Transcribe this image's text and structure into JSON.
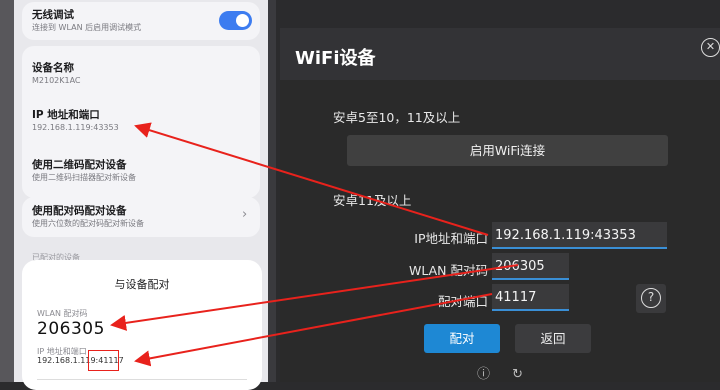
{
  "phone": {
    "wireless_debug": {
      "title": "无线调试",
      "sub": "连接到 WLAN 后启用调试模式"
    },
    "device_name": {
      "title": "设备名称",
      "sub": "M2102K1AC"
    },
    "ip_port": {
      "title": "IP 地址和端口",
      "sub": "192.168.1.119:43353"
    },
    "qr_pair": {
      "title": "使用二维码配对设备",
      "sub": "使用二维码扫描器配对新设备"
    },
    "code_pair": {
      "title": "使用配对码配对设备",
      "sub": "使用六位数的配对码配对新设备"
    },
    "faint": "已配对的设备",
    "pair_sheet": {
      "title": "与设备配对",
      "code_label": "WLAN 配对码",
      "code": "206305",
      "ip_label": "IP 地址和端口",
      "ip": "192.168.1.119:41117"
    }
  },
  "dialog": {
    "title": "WiFi设备",
    "section1": "安卓5至10，11及以上",
    "enable_button": "启用WiFi连接",
    "section2": "安卓11及以上",
    "ip_label": "IP地址和端口",
    "ip_value": "192.168.1.119:43353",
    "code_label": "WLAN 配对码",
    "code_value": "206305",
    "port_label": "配对端口",
    "port_value": "41117",
    "pair_button": "配对",
    "back_button": "返回"
  },
  "colors": {
    "accent": "#1e88d4",
    "annotation": "#e8221c",
    "toggle_on": "#3c7cf0"
  }
}
